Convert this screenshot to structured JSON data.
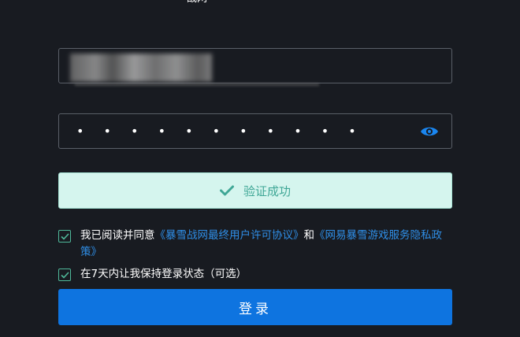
{
  "header": {
    "logo_text": "战网"
  },
  "form": {
    "account_value": "",
    "password_mask": "• • • • • • • • • • •"
  },
  "verify": {
    "label": "验证成功"
  },
  "terms": {
    "prefix": "我已阅读并同意",
    "link1": "《暴雪战网最终用户许可协议》",
    "middle": "和",
    "link2": "《网易暴雪游戏服务隐私政策》",
    "checked": true
  },
  "remember": {
    "label": "在7天内让我保持登录状态（可选）",
    "checked": true
  },
  "login_button": {
    "label": "登录"
  },
  "colors": {
    "background": "#181b21",
    "accent": "#0e74e0",
    "success_bg": "#d5f5ee",
    "success_text": "#3fa796",
    "link": "#2f8ee6",
    "checkbox": "#4fb99a"
  }
}
